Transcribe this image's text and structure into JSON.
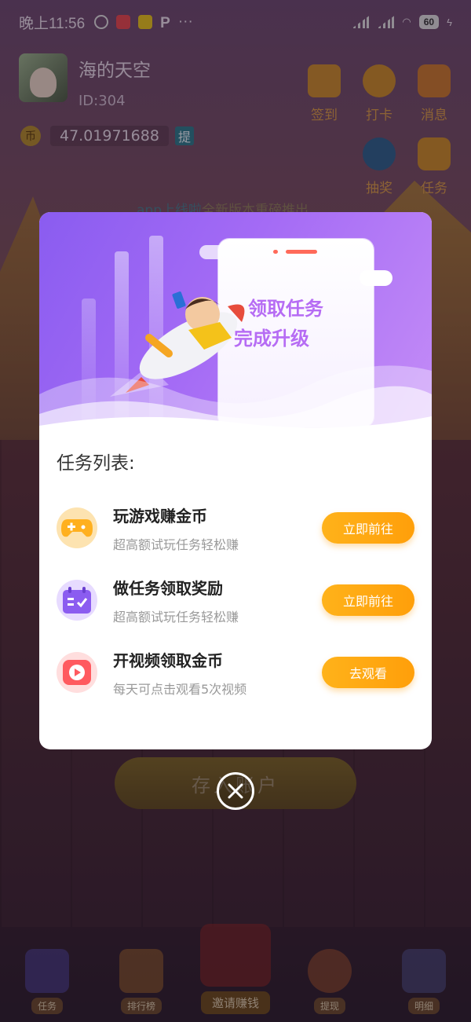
{
  "statusbar": {
    "time": "晚上11:56",
    "battery": "60"
  },
  "profile": {
    "name": "海的天空",
    "id": "ID:304"
  },
  "balance": {
    "coin_icon": "币",
    "amount": "47.01971688",
    "withdraw_tag": "提"
  },
  "top_icons": [
    {
      "label": "签到",
      "icon": "calendar-icon",
      "color": "#e7a12c"
    },
    {
      "label": "打卡",
      "icon": "check-icon",
      "color": "#d99a2a"
    },
    {
      "label": "消息",
      "icon": "mail-icon",
      "color": "#d6812e"
    },
    {
      "label": "抽奖",
      "icon": "compass-icon",
      "color": "#2c6fa8"
    },
    {
      "label": "任务",
      "icon": "calendar-task-icon",
      "color": "#d99a2a"
    }
  ],
  "marquee": {
    "highlight": "app上线啦",
    "text": "全新版本重磅推出"
  },
  "modal": {
    "headline_line1": "领取任务",
    "headline_line2": "完成升级",
    "list_title": "任务列表:",
    "tasks": [
      {
        "title": "玩游戏赚金币",
        "subtitle": "超高额试玩任务轻松赚",
        "button": "立即前往",
        "icon": "gamepad-icon",
        "color": "#fde3b0"
      },
      {
        "title": "做任务领取奖励",
        "subtitle": "超高额试玩任务轻松赚",
        "button": "立即前往",
        "icon": "calendar-check-icon",
        "color": "#e7dbff"
      },
      {
        "title": "开视频领取金币",
        "subtitle": "每天可点击观看5次视频",
        "button": "去观看",
        "icon": "play-icon",
        "color": "#ffdede"
      }
    ]
  },
  "save_button": "存入账户",
  "bottom_nav": [
    {
      "label": "任务"
    },
    {
      "label": "排行榜"
    },
    {
      "label": "邀请赚钱"
    },
    {
      "label": "提现"
    },
    {
      "label": "明细"
    }
  ],
  "colors": {
    "accent_purple": "#9b64f3",
    "button_orange": "#ffa90f"
  }
}
